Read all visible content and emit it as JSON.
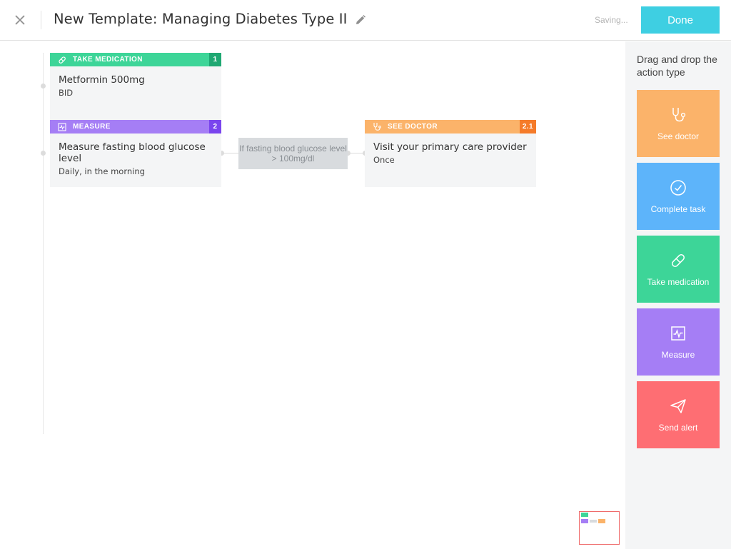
{
  "header": {
    "title": "New Template: Managing Diabetes Type II",
    "saving_status": "Saving...",
    "done_label": "Done"
  },
  "cards": [
    {
      "type_label": "TAKE MEDICATION",
      "number": "1",
      "title": "Metformin 500mg",
      "subtitle": "BID",
      "icon": "pill-icon",
      "color": "#3dd598",
      "badge_color": "#1fa872"
    },
    {
      "type_label": "MEASURE",
      "number": "2",
      "title": "Measure fasting blood glucose level",
      "subtitle": "Daily, in the morning",
      "icon": "chart-icon",
      "color": "#a57ef5",
      "badge_color": "#7a44ee"
    },
    {
      "type_label": "SEE DOCTOR",
      "number": "2.1",
      "title": "Visit your primary care provider",
      "subtitle": "Once",
      "icon": "stethoscope-icon",
      "color": "#fbb36a",
      "badge_color": "#f57b2a"
    }
  ],
  "condition": {
    "text": "If fasting blood glucose level > 100mg/dl"
  },
  "sidebar": {
    "title": "Drag and drop the action type",
    "tiles": [
      {
        "label": "See doctor",
        "icon": "stethoscope-icon",
        "color": "#fbb36a"
      },
      {
        "label": "Complete task",
        "icon": "check-circle-icon",
        "color": "#5db4fa"
      },
      {
        "label": "Take medication",
        "icon": "pill-icon",
        "color": "#3dd598"
      },
      {
        "label": "Measure",
        "icon": "chart-icon",
        "color": "#a57ef5"
      },
      {
        "label": "Send alert",
        "icon": "paper-plane-icon",
        "color": "#fe6e73"
      }
    ]
  },
  "colors": {
    "accent": "#3ecfe2",
    "minimap_border": "#ef6b6b"
  }
}
